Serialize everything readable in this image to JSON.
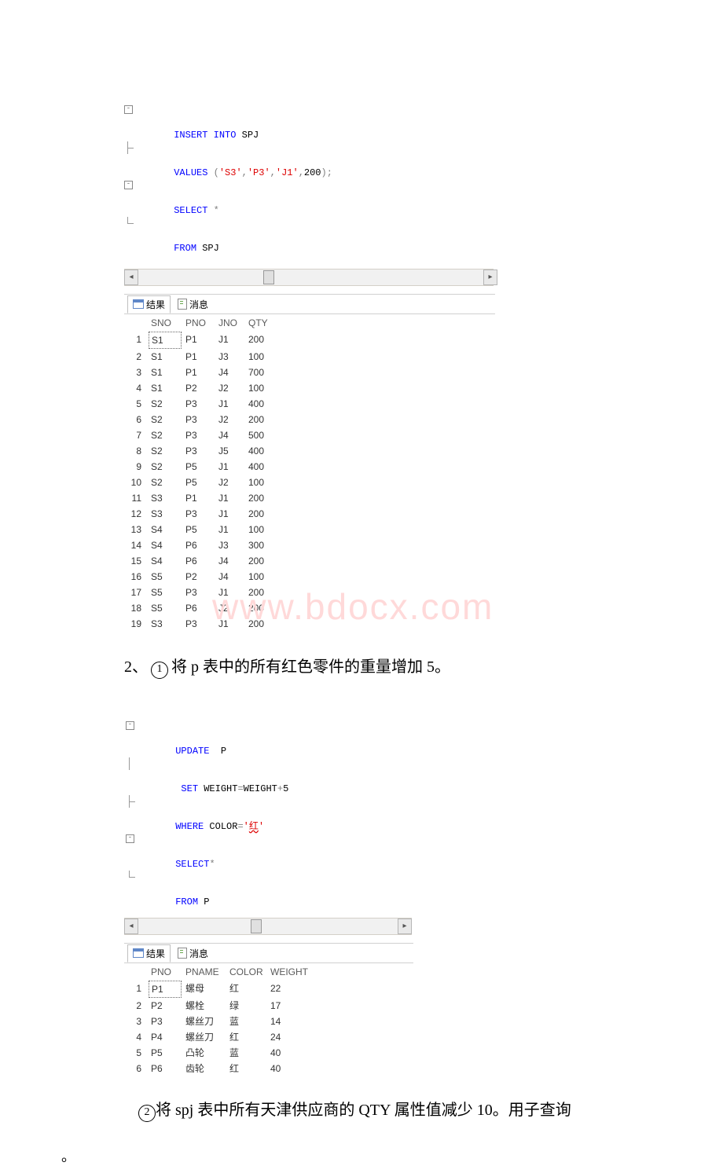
{
  "sql_block_1": {
    "l1_a": "INSERT",
    "l1_b": " INTO",
    "l1_c": " SPJ",
    "l2_a": "VALUES ",
    "l2_b": "(",
    "l2_c": "'S3'",
    "l2_d": ",",
    "l2_e": "'P3'",
    "l2_f": ",",
    "l2_g": "'J1'",
    "l2_h": ",",
    "l2_i": "200",
    "l2_j": ");",
    "l3_a": "SELECT",
    "l3_b": " *",
    "l4_a": "FROM",
    "l4_b": " SPJ"
  },
  "tabs": {
    "results": "结果",
    "messages": "消息"
  },
  "table1": {
    "headers": [
      "SNO",
      "PNO",
      "JNO",
      "QTY"
    ],
    "rows": [
      [
        "S1",
        "P1",
        "J1",
        "200"
      ],
      [
        "S1",
        "P1",
        "J3",
        "100"
      ],
      [
        "S1",
        "P1",
        "J4",
        "700"
      ],
      [
        "S1",
        "P2",
        "J2",
        "100"
      ],
      [
        "S2",
        "P3",
        "J1",
        "400"
      ],
      [
        "S2",
        "P3",
        "J2",
        "200"
      ],
      [
        "S2",
        "P3",
        "J4",
        "500"
      ],
      [
        "S2",
        "P3",
        "J5",
        "400"
      ],
      [
        "S2",
        "P5",
        "J1",
        "400"
      ],
      [
        "S2",
        "P5",
        "J2",
        "100"
      ],
      [
        "S3",
        "P1",
        "J1",
        "200"
      ],
      [
        "S3",
        "P3",
        "J1",
        "200"
      ],
      [
        "S4",
        "P5",
        "J1",
        "100"
      ],
      [
        "S4",
        "P6",
        "J3",
        "300"
      ],
      [
        "S4",
        "P6",
        "J4",
        "200"
      ],
      [
        "S5",
        "P2",
        "J4",
        "100"
      ],
      [
        "S5",
        "P3",
        "J1",
        "200"
      ],
      [
        "S5",
        "P6",
        "J2",
        "200"
      ],
      [
        "S3",
        "P3",
        "J1",
        "200"
      ]
    ]
  },
  "question1": {
    "idx": "2、",
    "circle": "1",
    "text": "将 p 表中的所有红色零件的重量增加 5。"
  },
  "watermark": {
    "a": "www",
    "b": "bdocx",
    "c": "com"
  },
  "sql_block_2": {
    "l1_a": "UPDATE",
    "l1_b": "P",
    "l2_a": "SET",
    "l2_b": " WEIGHT",
    "l2_c": "=",
    "l2_d": "WEIGHT",
    "l2_e": "+",
    "l2_f": "5",
    "l3_a": "WHERE",
    "l3_b": " COLOR",
    "l3_c": "=",
    "l3_d": "'",
    "l3_e": "红",
    "l3_f": "'",
    "l4_a": "SELECT",
    "l4_b": "*",
    "l5_a": "FROM",
    "l5_b": " P"
  },
  "table2": {
    "headers": [
      "PNO",
      "PNAME",
      "COLOR",
      "WEIGHT"
    ],
    "rows": [
      [
        "P1",
        "螺母",
        "红",
        "22"
      ],
      [
        "P2",
        "螺栓",
        "绿",
        "17"
      ],
      [
        "P3",
        "螺丝刀",
        "蓝",
        "14"
      ],
      [
        "P4",
        "螺丝刀",
        "红",
        "24"
      ],
      [
        "P5",
        "凸轮",
        "蓝",
        "40"
      ],
      [
        "P6",
        "齿轮",
        "红",
        "40"
      ]
    ]
  },
  "question2": {
    "circle": "2",
    "text": "将 spj 表中所有天津供应商的 QTY 属性值减少 10。用子查询",
    "tail": "。"
  }
}
